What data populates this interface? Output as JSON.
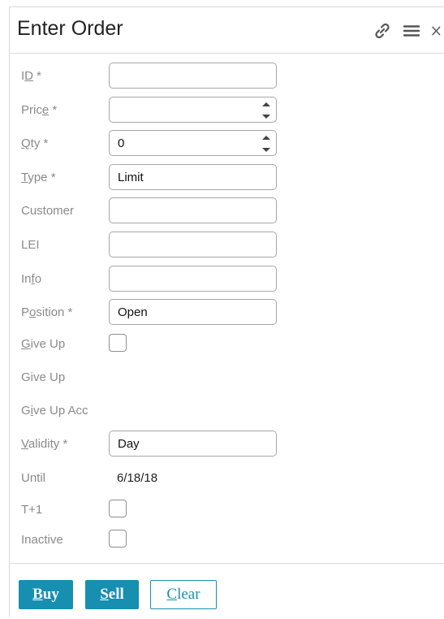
{
  "header": {
    "title": "Enter Order",
    "icons": [
      "link-icon",
      "menu-icon",
      "close-icon"
    ]
  },
  "form": {
    "id": {
      "label_pre": "I",
      "label_u": "D",
      "label_post": " *",
      "value": ""
    },
    "price": {
      "label_pre": "Pric",
      "label_u": "e",
      "label_post": " *",
      "value": ""
    },
    "qty": {
      "label_pre": "",
      "label_u": "Q",
      "label_post": "ty *",
      "value": "0"
    },
    "type": {
      "label_pre": "",
      "label_u": "T",
      "label_post": "ype *",
      "value": "Limit"
    },
    "customer": {
      "label": "Customer",
      "value": ""
    },
    "lei": {
      "label": "LEI",
      "value": ""
    },
    "info": {
      "label_pre": "In",
      "label_u": "f",
      "label_post": "o",
      "value": ""
    },
    "position": {
      "label_pre": "P",
      "label_u": "o",
      "label_post": "sition *",
      "value": "Open"
    },
    "give_up_chk": {
      "label_pre": "",
      "label_u": "G",
      "label_post": "ive Up",
      "checked": false
    },
    "give_up": {
      "label": "Give Up"
    },
    "give_up_acc": {
      "label_pre": "G",
      "label_u": "i",
      "label_post": "ve Up Acc"
    },
    "validity": {
      "label_pre": "",
      "label_u": "V",
      "label_post": "alidity *",
      "value": "Day"
    },
    "until": {
      "label": "Until",
      "value": "6/18/18"
    },
    "t_plus_1": {
      "label": "T+1",
      "checked": false
    },
    "inactive": {
      "label": "Inactive",
      "checked": false
    }
  },
  "footer": {
    "buy": {
      "u": "B",
      "rest": "uy"
    },
    "sell": {
      "u": "S",
      "rest": "ell"
    },
    "clear": {
      "u": "C",
      "rest": "lear"
    }
  },
  "colors": {
    "accent": "#178fb1",
    "label": "#8a8a8a",
    "border": "#a7a7a7"
  }
}
